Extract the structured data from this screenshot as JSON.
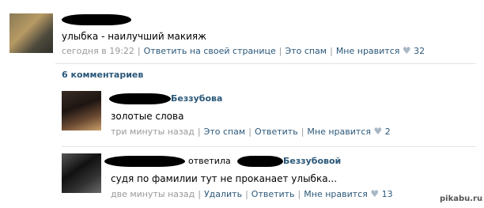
{
  "post": {
    "text": "улыбка - наилучший макияж",
    "date": "сегодня в 19:22",
    "reply_link": "Ответить на своей странице",
    "spam_link": "Это спам",
    "like_link": "Мне нравится",
    "like_count": "32"
  },
  "comments_header": "6 комментариев",
  "comments": [
    {
      "author_tail": "Беззубова",
      "text": "золотые слова",
      "time": "три минуты назад",
      "spam_link": "Это спам",
      "reply_link": "Ответить",
      "like_link": "Мне нравится",
      "like_count": "2"
    },
    {
      "reply_word": "ответила",
      "reply_to_tail": "Беззубовой",
      "text": "судя по фамилии тут не проканает улыбка...",
      "time": "две минуты назад",
      "delete_link": "Удалить",
      "reply_link": "Ответить",
      "like_link": "Мне нравится",
      "like_count": "13"
    }
  ],
  "watermark": "pikabu.ru",
  "colors": {
    "link": "#2b587a",
    "meta": "#999999",
    "divider": "#dfe4ea",
    "heart": "#aab7c5"
  },
  "icons": [
    "heart-icon",
    "heart-icon",
    "heart-icon"
  ]
}
